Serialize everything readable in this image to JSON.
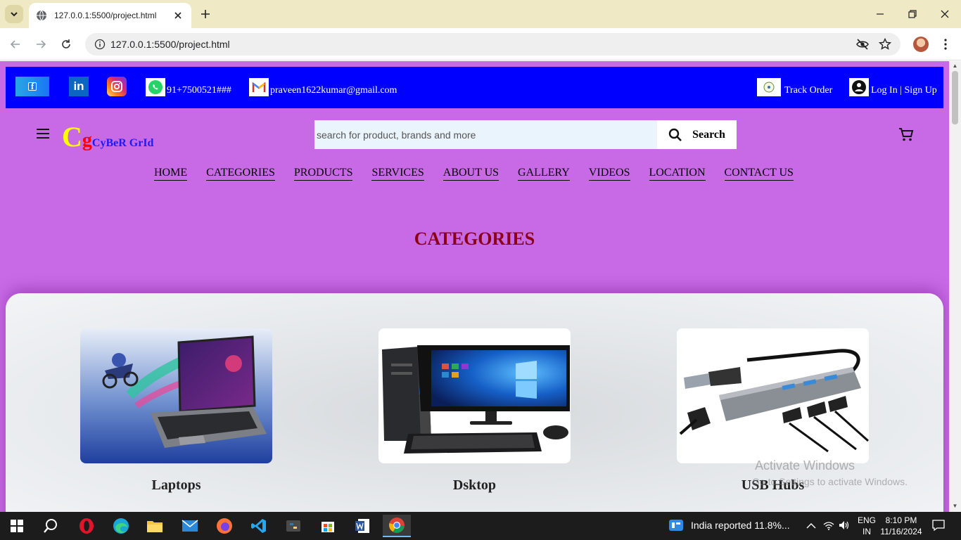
{
  "browser": {
    "tab_title": "127.0.0.1:5500/project.html",
    "url": "127.0.0.1:5500/project.html"
  },
  "topbar": {
    "phone": "91+7500521###",
    "email": "praveen1622kumar@gmail.com",
    "track_order": "Track Order",
    "login": "Log In | Sign Up",
    "facebook_glyph": "f",
    "linkedin_glyph": "in"
  },
  "header": {
    "logo_c": "C",
    "logo_g": "g",
    "logo_text": "CyBeR GrId",
    "search_placeholder": "search for product, brands and more",
    "search_button": "Search"
  },
  "nav": [
    "HOME",
    "CATEGORIES",
    "PRODUCTS",
    "SERVICES",
    "ABOUT US",
    "GALLERY",
    "VIDEOS",
    "LOCATION",
    "CONTACT US"
  ],
  "section": {
    "title": "CATEGORIES"
  },
  "categories": [
    {
      "label": "Laptops"
    },
    {
      "label": "Dsktop"
    },
    {
      "label": "USB Hubs"
    }
  ],
  "watermark": {
    "line1": "Activate Windows",
    "line2": "Go to Settings to activate Windows."
  },
  "taskbar": {
    "news": "India reported 11.8%...",
    "lang1": "ENG",
    "lang2": "IN",
    "time": "8:10 PM",
    "date": "11/16/2024"
  },
  "colors": {
    "page_bg": "#c86ae5",
    "topbar_bg": "#0000ff",
    "title": "#8b0015",
    "logo_c": "#ffff00",
    "logo_g": "#ff0000",
    "logo_text": "#1a1aff"
  }
}
